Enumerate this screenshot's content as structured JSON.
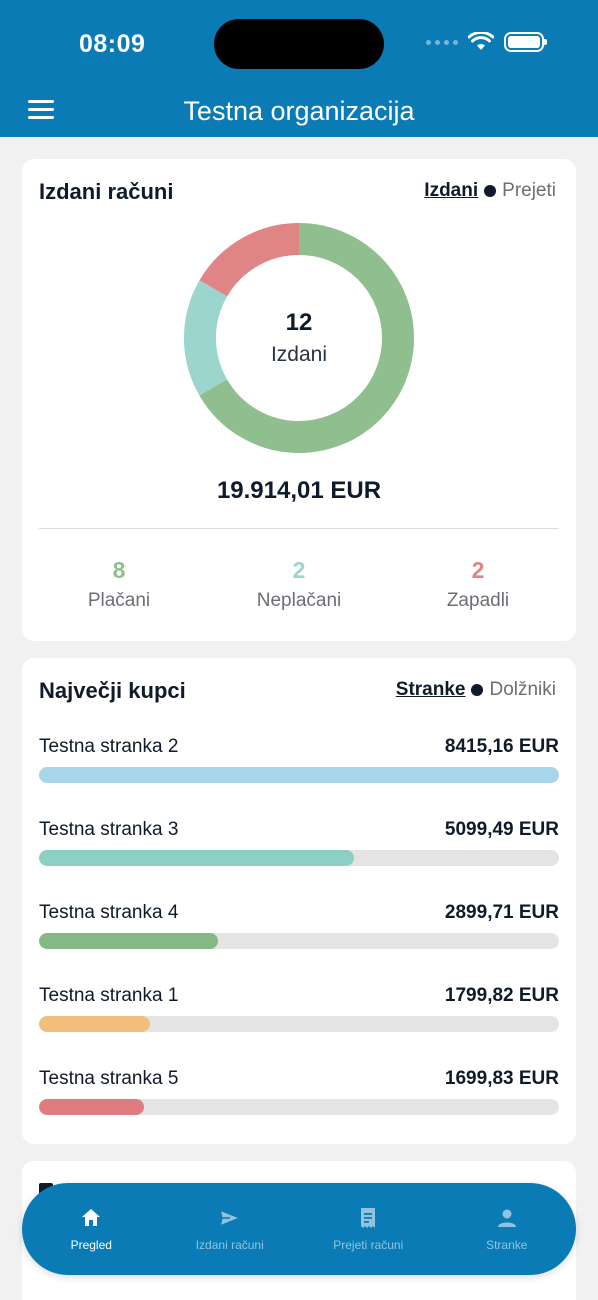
{
  "status_bar": {
    "time": "08:09"
  },
  "header": {
    "title": "Testna organizacija"
  },
  "invoices_card": {
    "title": "Izdani računi",
    "toggle_active": "Izdani",
    "toggle_inactive": "Prejeti",
    "donut": {
      "count": "12",
      "label": "Izdani"
    },
    "total": "19.914,01 EUR",
    "stats": [
      {
        "value": "8",
        "label": "Plačani",
        "color": "#8fbf8f"
      },
      {
        "value": "2",
        "label": "Neplačani",
        "color": "#9bd5cd"
      },
      {
        "value": "2",
        "label": "Zapadli",
        "color": "#e08585"
      }
    ]
  },
  "customers_card": {
    "title": "Največji kupci",
    "toggle_active": "Stranke",
    "toggle_inactive": "Dolžniki",
    "rows": [
      {
        "name": "Testna stranka 2",
        "amount": "8415,16 EUR",
        "fill": 1.0,
        "color": "#a7d5ea"
      },
      {
        "name": "Testna stranka 3",
        "amount": "5099,49 EUR",
        "fill": 0.606,
        "color": "#8ccfc4"
      },
      {
        "name": "Testna stranka 4",
        "amount": "2899,71 EUR",
        "fill": 0.345,
        "color": "#86b886"
      },
      {
        "name": "Testna stranka 1",
        "amount": "1799,82 EUR",
        "fill": 0.214,
        "color": "#f0bf7c"
      },
      {
        "name": "Testna stranka 5",
        "amount": "1699,83 EUR",
        "fill": 0.202,
        "color": "#e07b80"
      }
    ]
  },
  "nav": {
    "items": [
      {
        "label": "Pregled",
        "icon": "home-icon"
      },
      {
        "label": "Izdani računi",
        "icon": "send-icon"
      },
      {
        "label": "Prejeti računi",
        "icon": "receipt-icon"
      },
      {
        "label": "Stranke",
        "icon": "person-icon"
      }
    ]
  }
}
